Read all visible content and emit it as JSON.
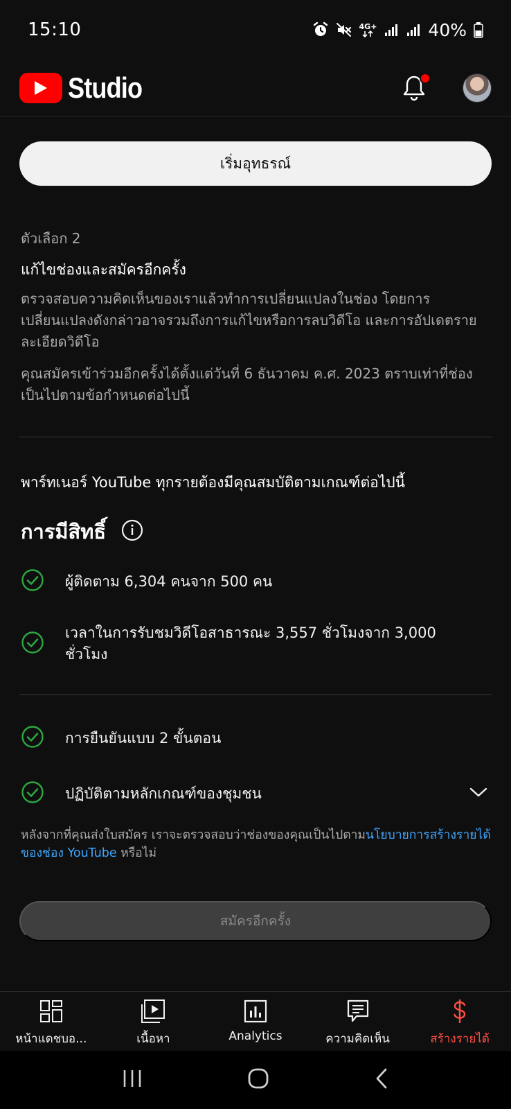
{
  "status_bar": {
    "time": "15:10",
    "network": "4G+",
    "battery": "40%",
    "icons": [
      "alarm-icon",
      "mute-icon",
      "network-icon",
      "signal-icon",
      "signal-icon",
      "battery-icon"
    ]
  },
  "header": {
    "app_name": "Studio",
    "brand_color": "#ff0000"
  },
  "content": {
    "option1_button": "เริ่มอุทธรณ์",
    "option2": {
      "label": "ตัวเลือก 2",
      "title": "แก้ไขช่องและสมัครอีกครั้ง",
      "description1": "ตรวจสอบความคิดเห็นของเราแล้วทำการเปลี่ยนแปลงในช่อง โดยการเปลี่ยนแปลงดังกล่าวอาจรวมถึงการแก้ไขหรือการลบวิดีโอ และการอัปเดตรายละเอียดวิดีโอ",
      "description2": "คุณสมัครเข้าร่วมอีกครั้งได้ตั้งแต่วันที่ 6 ธันวาคม ค.ศ. 2023 ตราบเท่าที่ช่องเป็นไปตามข้อกำหนดต่อไปนี้"
    },
    "partner_requirement": "พาร์ทเนอร์ YouTube ทุกรายต้องมีคุณสมบัติตามเกณฑ์ต่อไปนี้",
    "eligibility_title": "การมีสิทธิ์",
    "requirements": [
      "ผู้ติดตาม 6,304 คนจาก 500 คน",
      "เวลาในการรับชมวิดีโอสาธารณะ 3,557 ชั่วโมงจาก 3,000 ชั่วโมง",
      "การยืนยันแบบ 2 ขั้นตอน",
      "ปฏิบัติตามหลักเกณฑ์ของชุมชน"
    ],
    "footnote_before": "หลังจากที่คุณส่งใบสมัคร เราจะตรวจสอบว่าช่องของคุณเป็นไปตาม",
    "footnote_link": "นโยบายการสร้างรายได้ของช่อง YouTube",
    "footnote_after": " หรือไม่",
    "reapply_button": "สมัครอีกครั้ง",
    "check_color": "#2ba640",
    "link_color": "#3ea6ff"
  },
  "bottom_nav": [
    {
      "label": "หน้าแดชบอ...",
      "icon": "dashboard-icon"
    },
    {
      "label": "เนื้อหา",
      "icon": "content-icon"
    },
    {
      "label": "Analytics",
      "icon": "analytics-icon"
    },
    {
      "label": "ความคิดเห็น",
      "icon": "comments-icon"
    },
    {
      "label": "สร้างรายได้",
      "icon": "earn-icon",
      "active": true,
      "color": "#ff4e45"
    }
  ]
}
